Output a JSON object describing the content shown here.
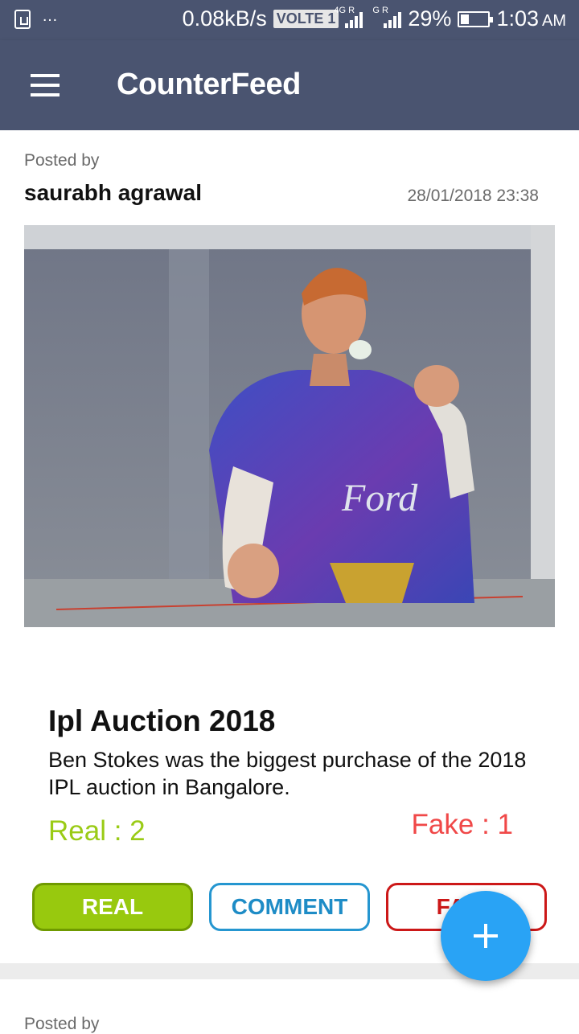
{
  "status_bar": {
    "speed": "0.08kB/s",
    "volte": "VOLTE 1",
    "net1": "4G R",
    "net2": "G R",
    "battery": "29%",
    "time": "1:03",
    "ampm": "AM"
  },
  "app_bar": {
    "title": "CounterFeed",
    "menu_icon": "hamburger-menu-icon"
  },
  "post": {
    "posted_by_label": "Posted by",
    "author": "saurabh agrawal",
    "timestamp": "28/01/2018 23:38",
    "title": "Ipl Auction 2018",
    "body": "Ben Stokes was the biggest purchase of the 2018 IPL auction in Bangalore.",
    "real_count": "Real : 2",
    "fake_count": "Fake : 1",
    "image_jersey_text": "Ford",
    "buttons": {
      "real": "REAL",
      "comment": "COMMENT",
      "fake": "FAKE"
    }
  },
  "next_post": {
    "posted_by_label": "Posted by"
  },
  "fab": {
    "icon": "plus-icon"
  },
  "colors": {
    "app_bar": "#4a5470",
    "real": "#98c90e",
    "comment": "#2596d0",
    "fake": "#cc1818",
    "fab": "#29a3f5"
  }
}
